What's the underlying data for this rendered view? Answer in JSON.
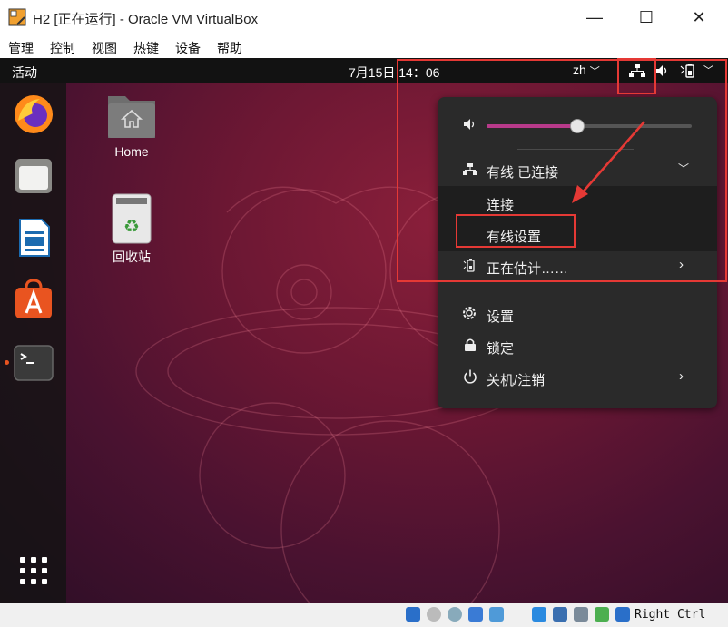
{
  "window": {
    "title": "H2 [正在运行] - Oracle VM VirtualBox",
    "minimize": "—",
    "maximize": "☐",
    "close": "✕"
  },
  "menubar": {
    "items": [
      "管理",
      "控制",
      "视图",
      "热键",
      "设备",
      "帮助"
    ]
  },
  "topbar": {
    "activities": "活动",
    "clock": "7月15日  14：06",
    "lang": "zh"
  },
  "desktop": {
    "home_label": "Home",
    "trash_label": "回收站"
  },
  "panel": {
    "wired_status": "有线 已连接",
    "connect": "连接",
    "wired_settings": "有线设置",
    "battery": "正在估计……",
    "settings": "设置",
    "lock": "锁定",
    "power": "关机/注销",
    "volume_level": 0.44
  },
  "statusbar": {
    "host_key": "Right Ctrl"
  }
}
